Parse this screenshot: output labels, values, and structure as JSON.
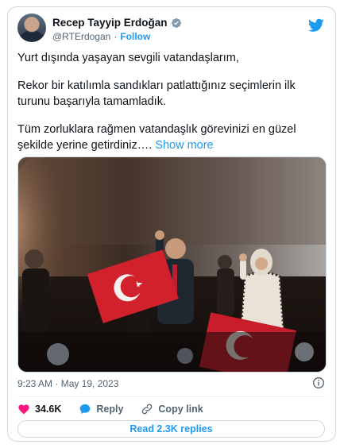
{
  "author": {
    "name": "Recep Tayyip Erdoğan",
    "handle": "@RTErdogan",
    "separator": "·",
    "follow_label": "Follow"
  },
  "tweet": {
    "paragraphs": [
      "Yurt dışında yaşayan sevgili vatandaşlarım,",
      "Rekor bir katılımla sandıkları patlattığınız seçimlerin ilk turunu başarıyla tamamladık.",
      "Tüm zorluklara rağmen vatandaşlık görevinizi en güzel şekilde yerine getirdiniz…."
    ],
    "show_more_label": "Show more",
    "timestamp": "9:23 AM · May 19, 2023"
  },
  "actions": {
    "like_count": "34.6K",
    "reply_label": "Reply",
    "copy_link_label": "Copy link",
    "read_replies_label": "Read 2.3K replies"
  },
  "colors": {
    "brand": "#1d9bf0",
    "like": "#f91880",
    "verified": "#829aab"
  },
  "icons": {
    "logo": "twitter-bird-icon",
    "verified": "verified-badge-icon",
    "info": "info-icon",
    "like": "heart-icon",
    "reply": "speech-bubble-icon",
    "copy": "link-icon"
  }
}
